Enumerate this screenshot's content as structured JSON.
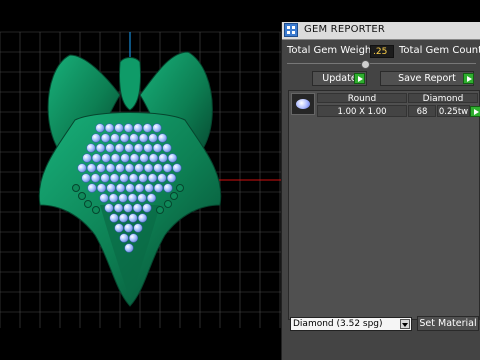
{
  "viewport": {
    "background": "#000000",
    "grid_color": "#4a4a4a",
    "axis_red": "#d01010",
    "axis_blue": "#1aa6ff",
    "model_color": "#0f8a5a",
    "gem_color": "#bcd6ff"
  },
  "panel": {
    "title": "GEM REPORTER",
    "icon": "gem-reporter-app-icon",
    "total_gem_weight_label": "Total Gem Weight",
    "total_gem_weight_value": ".25",
    "total_gem_count_label": "Total Gem Count",
    "update_label": "Update",
    "save_report_label": "Save Report",
    "table": {
      "headers": [
        "Round",
        "Diamond"
      ],
      "row": {
        "size": "1.00 X 1.00",
        "count": "68",
        "weight": "0.25tw"
      }
    },
    "material_select": "Diamond    (3.52 spg)",
    "set_material_label": "Set Material"
  }
}
